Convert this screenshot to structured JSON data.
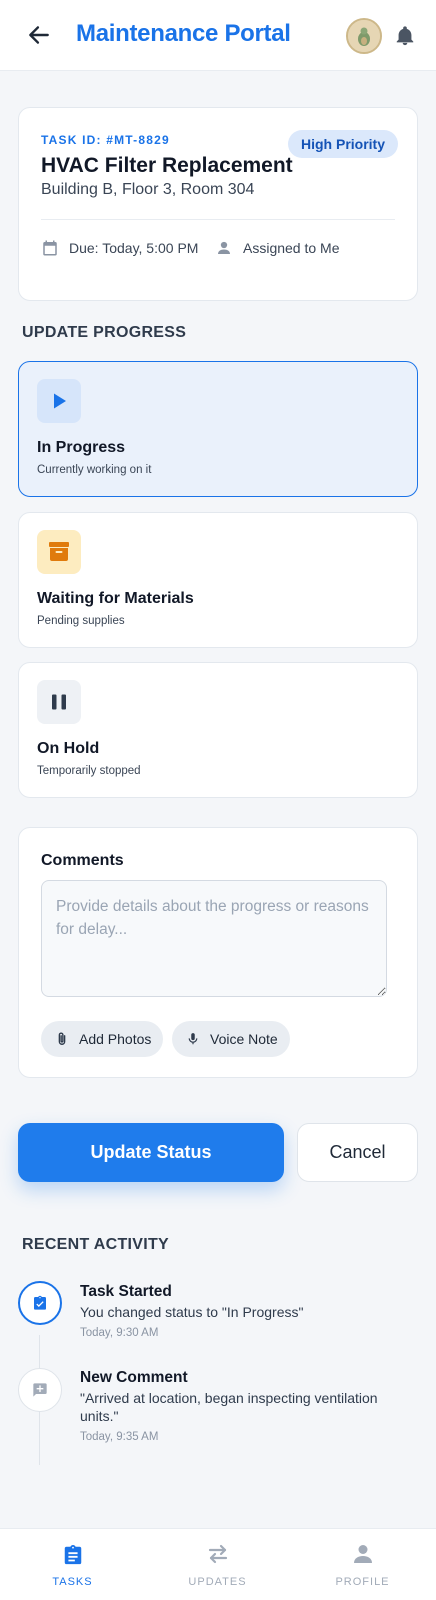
{
  "header": {
    "title": "Maintenance Portal"
  },
  "task": {
    "id_label": "TASK ID: #MT-8829",
    "priority": "High Priority",
    "title": "HVAC Filter Replacement",
    "location": "Building B, Floor 3, Room 304",
    "due": "Due: Today, 5:00 PM",
    "assigned": "Assigned to Me"
  },
  "progress": {
    "section_label": "UPDATE PROGRESS",
    "options": [
      {
        "title": "In Progress",
        "subtitle": "Currently working on it",
        "icon": "play-icon",
        "selected": true
      },
      {
        "title": "Waiting for Materials",
        "subtitle": "Pending supplies",
        "icon": "archive-box-icon",
        "selected": false
      },
      {
        "title": "On Hold",
        "subtitle": "Temporarily stopped",
        "icon": "pause-icon",
        "selected": false
      }
    ]
  },
  "comments": {
    "label": "Comments",
    "value": "",
    "placeholder": "Provide details about the progress or reasons for delay...",
    "add_photos": "Add Photos",
    "voice_note": "Voice Note"
  },
  "actions": {
    "update": "Update Status",
    "cancel": "Cancel"
  },
  "activity": {
    "section_label": "RECENT ACTIVITY",
    "items": [
      {
        "title": "Task Started",
        "text": "You changed status to \"In Progress\"",
        "time": "Today, 9:30 AM",
        "icon": "clipboard-check-icon"
      },
      {
        "title": "New Comment",
        "text": "\"Arrived at location, began inspecting ventilation units.\"",
        "time": "Today, 9:35 AM",
        "icon": "comment-add-icon"
      }
    ]
  },
  "nav": {
    "items": [
      {
        "label": "TASKS",
        "icon": "clipboard-icon",
        "active": true
      },
      {
        "label": "UPDATES",
        "icon": "swap-arrows-icon",
        "active": false
      },
      {
        "label": "PROFILE",
        "icon": "person-icon",
        "active": false
      }
    ]
  },
  "colors": {
    "accent": "#1a73e8",
    "waiting_icon_bg": "#fdecc0",
    "waiting_icon": "#e07b0c"
  }
}
